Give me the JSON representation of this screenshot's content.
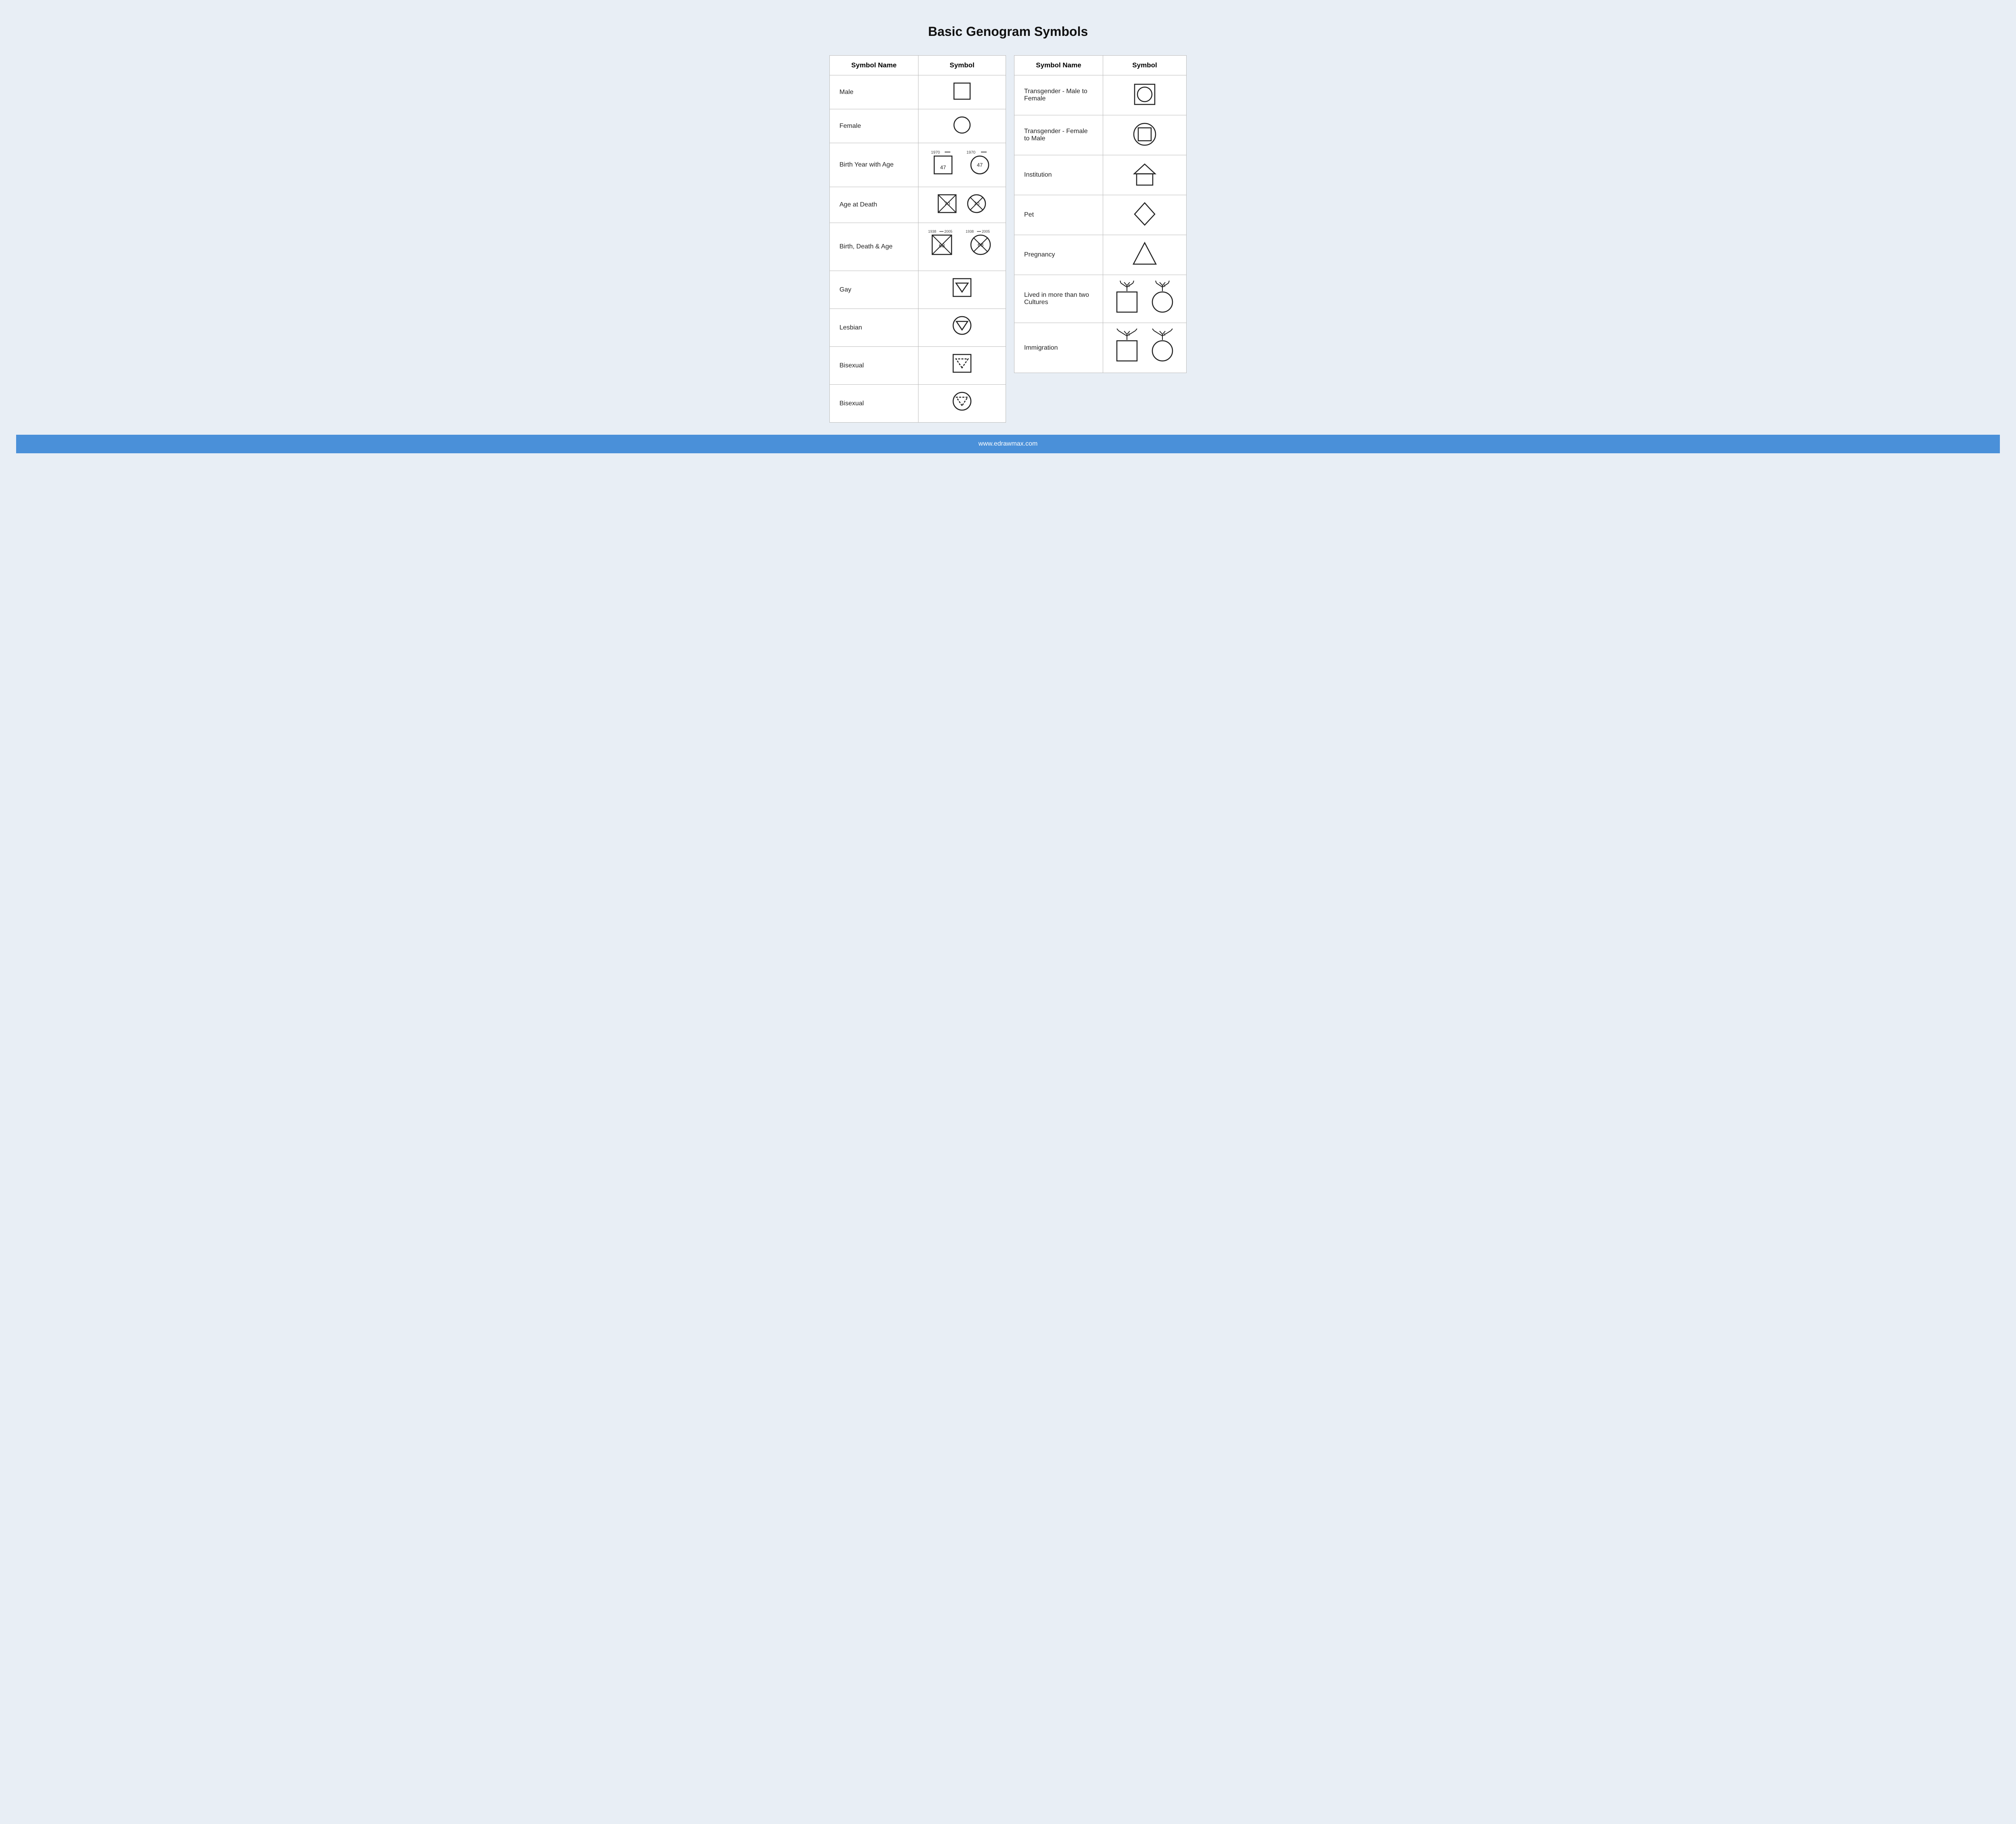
{
  "title": "Basic Genogram Symbols",
  "left_table": {
    "headers": [
      "Symbol Name",
      "Symbol"
    ],
    "rows": [
      {
        "name": "Male"
      },
      {
        "name": "Female"
      },
      {
        "name": "Birth Year with Age"
      },
      {
        "name": "Age at Death"
      },
      {
        "name": "Birth, Death & Age"
      },
      {
        "name": "Gay"
      },
      {
        "name": "Lesbian"
      },
      {
        "name": "Bisexual (male)"
      },
      {
        "name": "Bisexual (female)"
      }
    ]
  },
  "right_table": {
    "headers": [
      "Symbol Name",
      "Symbol"
    ],
    "rows": [
      {
        "name": "Transgender - Male to Female"
      },
      {
        "name": "Transgender - Female to Male"
      },
      {
        "name": "Institution"
      },
      {
        "name": "Pet"
      },
      {
        "name": "Pregnancy"
      },
      {
        "name": "Lived in more than two Cultures"
      },
      {
        "name": "Immigration"
      }
    ]
  },
  "footer": "www.edrawmax.com"
}
